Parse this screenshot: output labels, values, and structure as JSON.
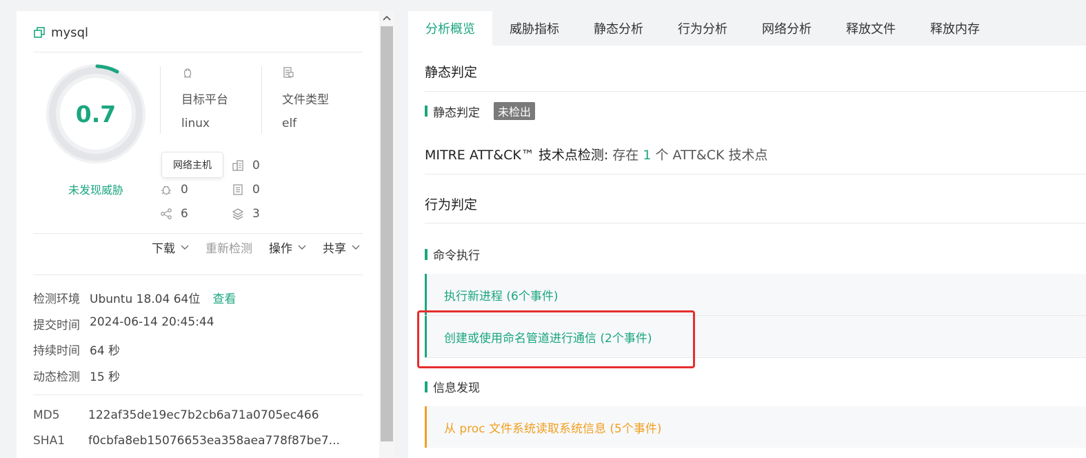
{
  "file": {
    "name": "mysql",
    "icon": "copy-icon"
  },
  "score": {
    "value": "0.7",
    "fraction": 0.07,
    "verdict": "未发现威胁"
  },
  "platform": {
    "icon": "linux-icon",
    "label": "目标平台",
    "value": "linux"
  },
  "filetype": {
    "icon": "file-type-icon",
    "label": "文件类型",
    "value": "elf"
  },
  "tooltip": "网络主机",
  "stats": [
    {
      "icon": "building-icon",
      "value": "0"
    },
    {
      "icon": "bug-icon",
      "value": "0"
    },
    {
      "icon": "document-list-icon",
      "value": "0"
    },
    {
      "icon": "network-icon",
      "value": "6"
    },
    {
      "icon": "layers-icon",
      "value": "3"
    }
  ],
  "actions": {
    "download": "下载",
    "redetect": "重新检测",
    "operate": "操作",
    "share": "共享"
  },
  "meta": {
    "env_label": "检测环境",
    "env_value": "Ubuntu 18.04 64位",
    "env_link": "查看",
    "submit_label": "提交时间",
    "submit_value": "2024-06-14 20:45:44",
    "duration_label": "持续时间",
    "duration_value": "64 秒",
    "dynamic_label": "动态检测",
    "dynamic_value": "15 秒"
  },
  "hashes": {
    "md5_label": "MD5",
    "md5_value": "122af35de19ec7b2cb6a71a0705ec466",
    "sha1_label": "SHA1",
    "sha1_value": "f0cbfa8eb15076653ea358aea778f87be7..."
  },
  "tabs": [
    "分析概览",
    "威胁指标",
    "静态分析",
    "行为分析",
    "网络分析",
    "释放文件",
    "释放内存"
  ],
  "static": {
    "title": "静态判定",
    "sub_label": "静态判定",
    "badge": "未检出"
  },
  "mitre": {
    "label": "MITRE ATT&CK™ 技术点检测:",
    "prefix": "存在",
    "count": "1",
    "suffix": "个 ATT&CK 技术点"
  },
  "behavior": {
    "title": "行为判定",
    "cmd_label": "命令执行",
    "event1": "执行新进程 (6个事件)",
    "event2": "创建或使用命名管道进行通信 (2个事件)",
    "info_label": "信息发现",
    "event3": "从 proc 文件系统读取系统信息 (5个事件)"
  },
  "colors": {
    "accent": "#1ba67f",
    "warning": "#f0a020",
    "highlight": "#e52e2e",
    "badge": "#7a7a7a"
  }
}
